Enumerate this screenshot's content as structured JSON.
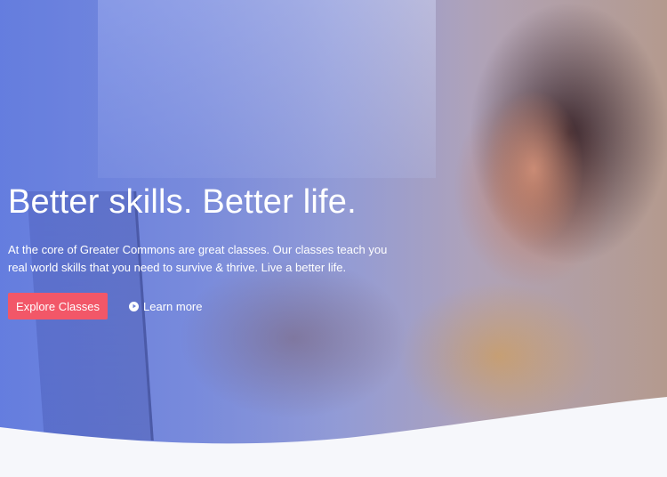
{
  "hero": {
    "headline": "Better skills. Better life.",
    "description": "At the core of Greater Commons are great classes. Our classes teach you real world skills that you need to survive & thrive. Live a better life.",
    "primary_button_label": "Explore Classes",
    "secondary_link_label": "Learn more",
    "secondary_link_icon": "play-circle-icon"
  },
  "colors": {
    "accent": "#f25768",
    "overlay": "#5c76e6",
    "page_background": "#f6f7fb"
  }
}
